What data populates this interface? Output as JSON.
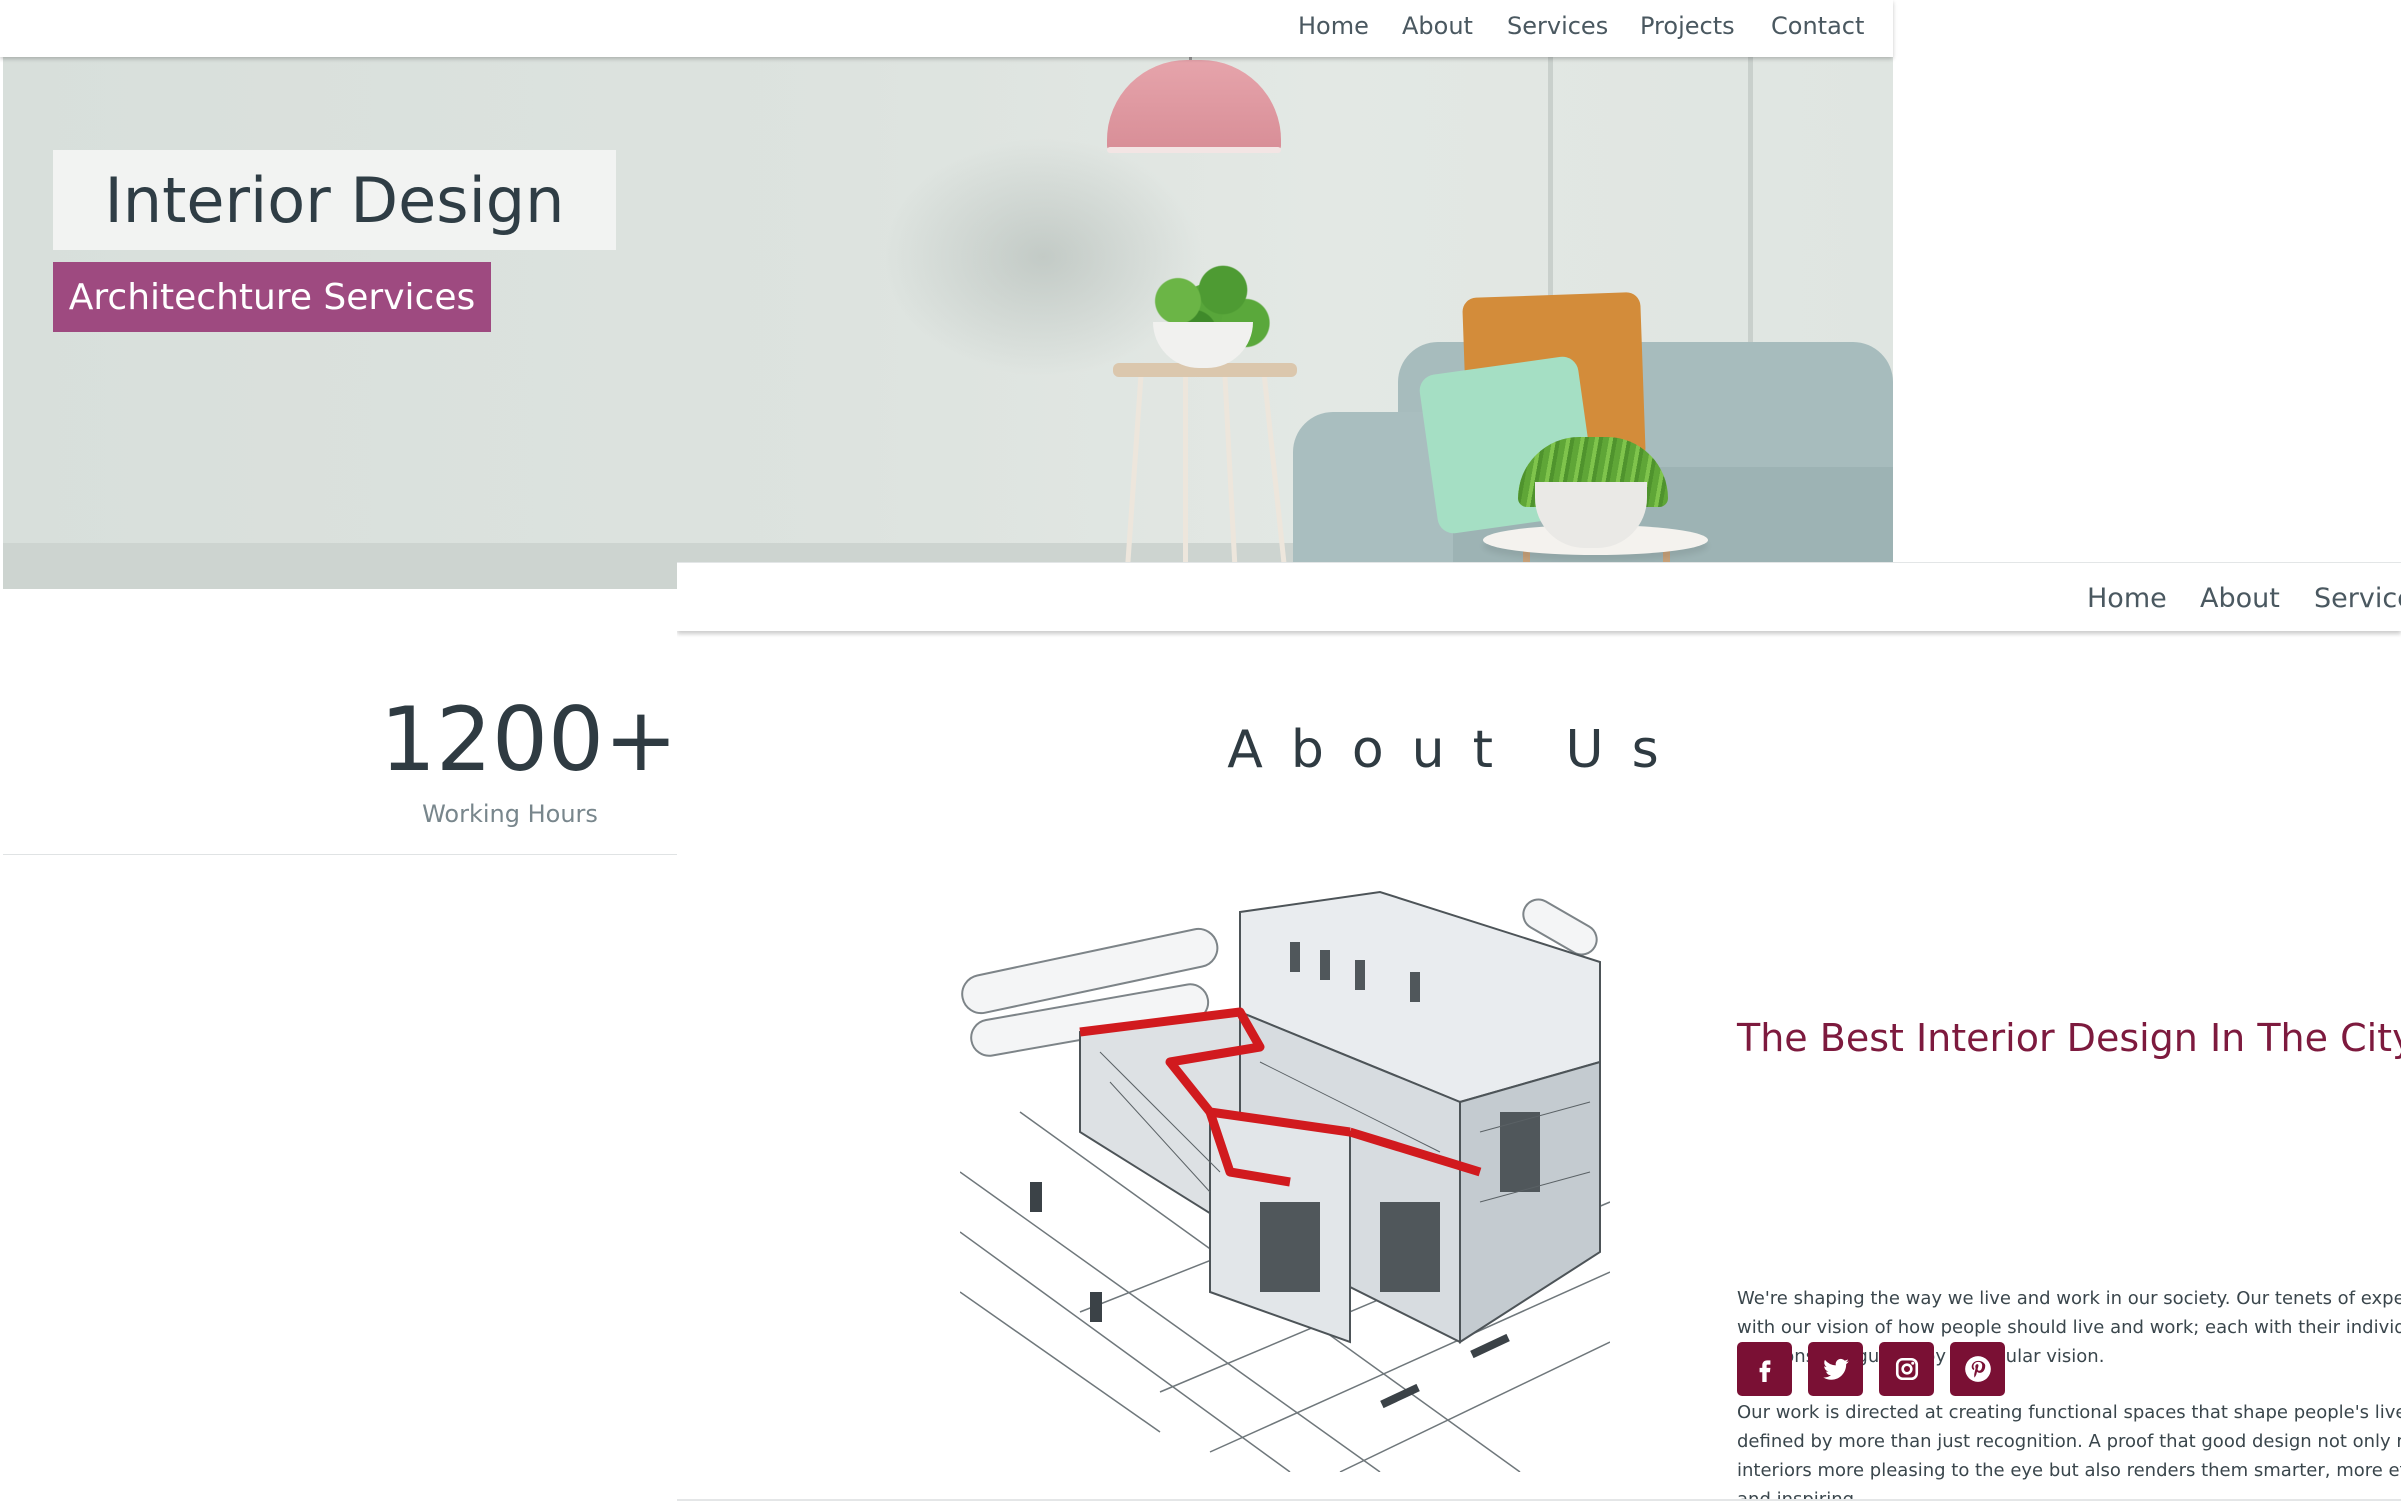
{
  "window1": {
    "nav": [
      "Home",
      "About",
      "Services",
      "Projects",
      "Contact"
    ],
    "hero": {
      "title": "Interior Design",
      "badge": "Architechture Services"
    },
    "stat": {
      "number": "1200+",
      "label": "Working Hours"
    }
  },
  "window2": {
    "nav": [
      "Home",
      "About",
      "Service"
    ],
    "about_title": "About Us",
    "section_title": "The Best Interior Design In The City",
    "paragraph1": [
      "We're shaping the way we live and work in our society. Our tenets of expertise",
      "with our vision of how people should live and work; each with their individual",
      "missions but guided by a singular vision."
    ],
    "paragraph2": [
      "Our work is directed at creating functional spaces that shape people's lives. It",
      "defined by more than just recognition. A proof that good design not only make",
      "interiors more pleasing to the eye but also renders them smarter, more efficie",
      "and inspiring."
    ],
    "social": [
      "facebook-icon",
      "twitter-icon",
      "instagram-icon",
      "pinterest-icon"
    ],
    "colors": {
      "accent": "#7a1034",
      "badge": "#9e4a80",
      "heading": "#7d1a3e"
    }
  }
}
